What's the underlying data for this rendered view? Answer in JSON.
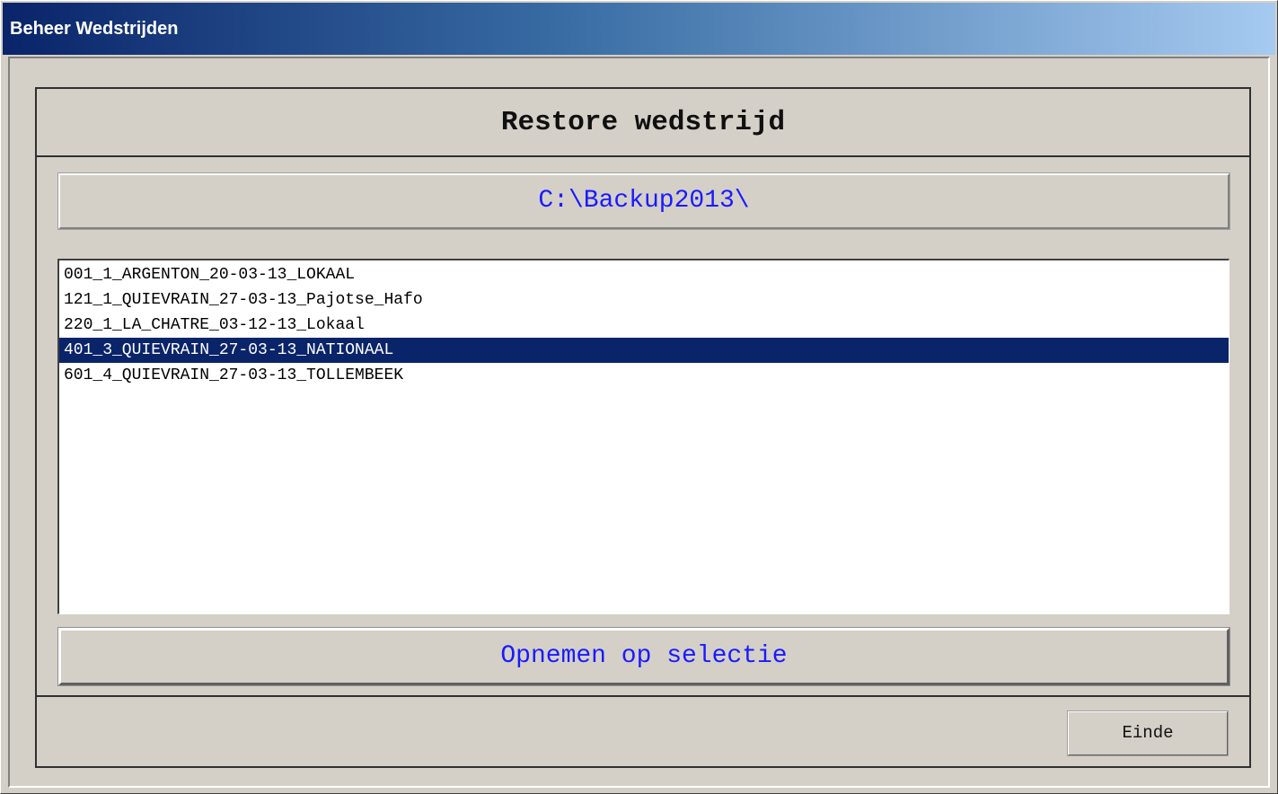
{
  "window": {
    "title": "Beheer Wedstrijden"
  },
  "panel": {
    "heading": "Restore wedstrijd",
    "path": "C:\\Backup2013\\"
  },
  "list": {
    "items": [
      "001_1_ARGENTON_20-03-13_LOKAAL",
      "121_1_QUIEVRAIN_27-03-13_Pajotse_Hafo",
      "220_1_LA_CHATRE_03-12-13_Lokaal",
      "401_3_QUIEVRAIN_27-03-13_NATIONAAL",
      "601_4_QUIEVRAIN_27-03-13_TOLLEMBEEK"
    ],
    "selected_index": 3
  },
  "buttons": {
    "action_label": "Opnemen op selectie",
    "close_label": "Einde"
  },
  "colors": {
    "selection": "#0a246a",
    "accent_text": "#1a1aff",
    "face": "#d4d0c8"
  }
}
